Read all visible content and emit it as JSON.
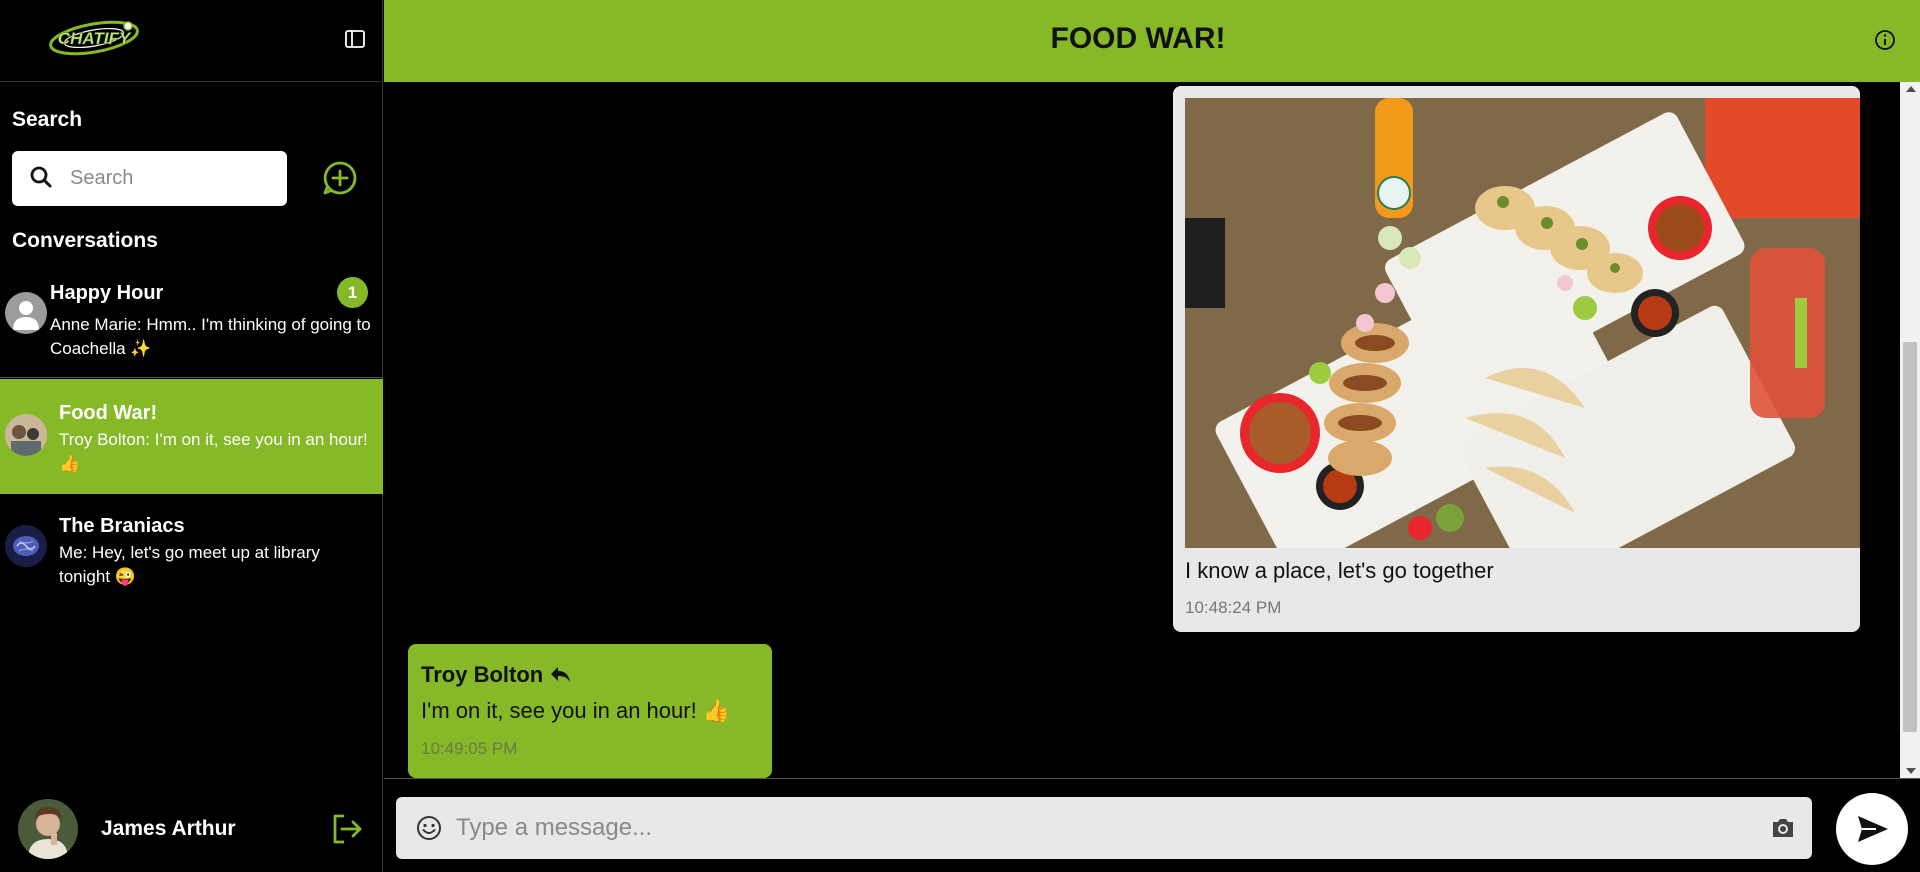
{
  "app": {
    "logo_text": "CHATIFY"
  },
  "sidebar": {
    "search_title": "Search",
    "search_placeholder": "Search",
    "conversations_title": "Conversations",
    "conversations": [
      {
        "name": "Happy Hour",
        "preview": "Anne Marie: Hmm.. I'm thinking of going to Coachella ✨",
        "unread": "1",
        "active": false
      },
      {
        "name": "Food War!",
        "preview": "Troy Bolton: I'm on it, see you in an hour! 👍",
        "unread": "",
        "active": true
      },
      {
        "name": "The Braniacs",
        "preview": "Me: Hey, let's go meet up at library tonight 😜",
        "unread": "",
        "active": false
      }
    ],
    "current_user": {
      "name": "James Arthur"
    }
  },
  "chat": {
    "title": "FOOD WAR!",
    "messages": [
      {
        "direction": "outgoing",
        "text": "I know a place, let's go together",
        "time": "10:48:24 PM",
        "has_image": true
      },
      {
        "direction": "incoming",
        "sender": "Troy Bolton",
        "text": "I'm on it, see you in an hour! 👍",
        "time": "10:49:05 PM"
      }
    ],
    "composer_placeholder": "Type a message..."
  },
  "colors": {
    "accent": "#86b927",
    "bubble_out": "#e8e8ea",
    "background": "#000000"
  }
}
